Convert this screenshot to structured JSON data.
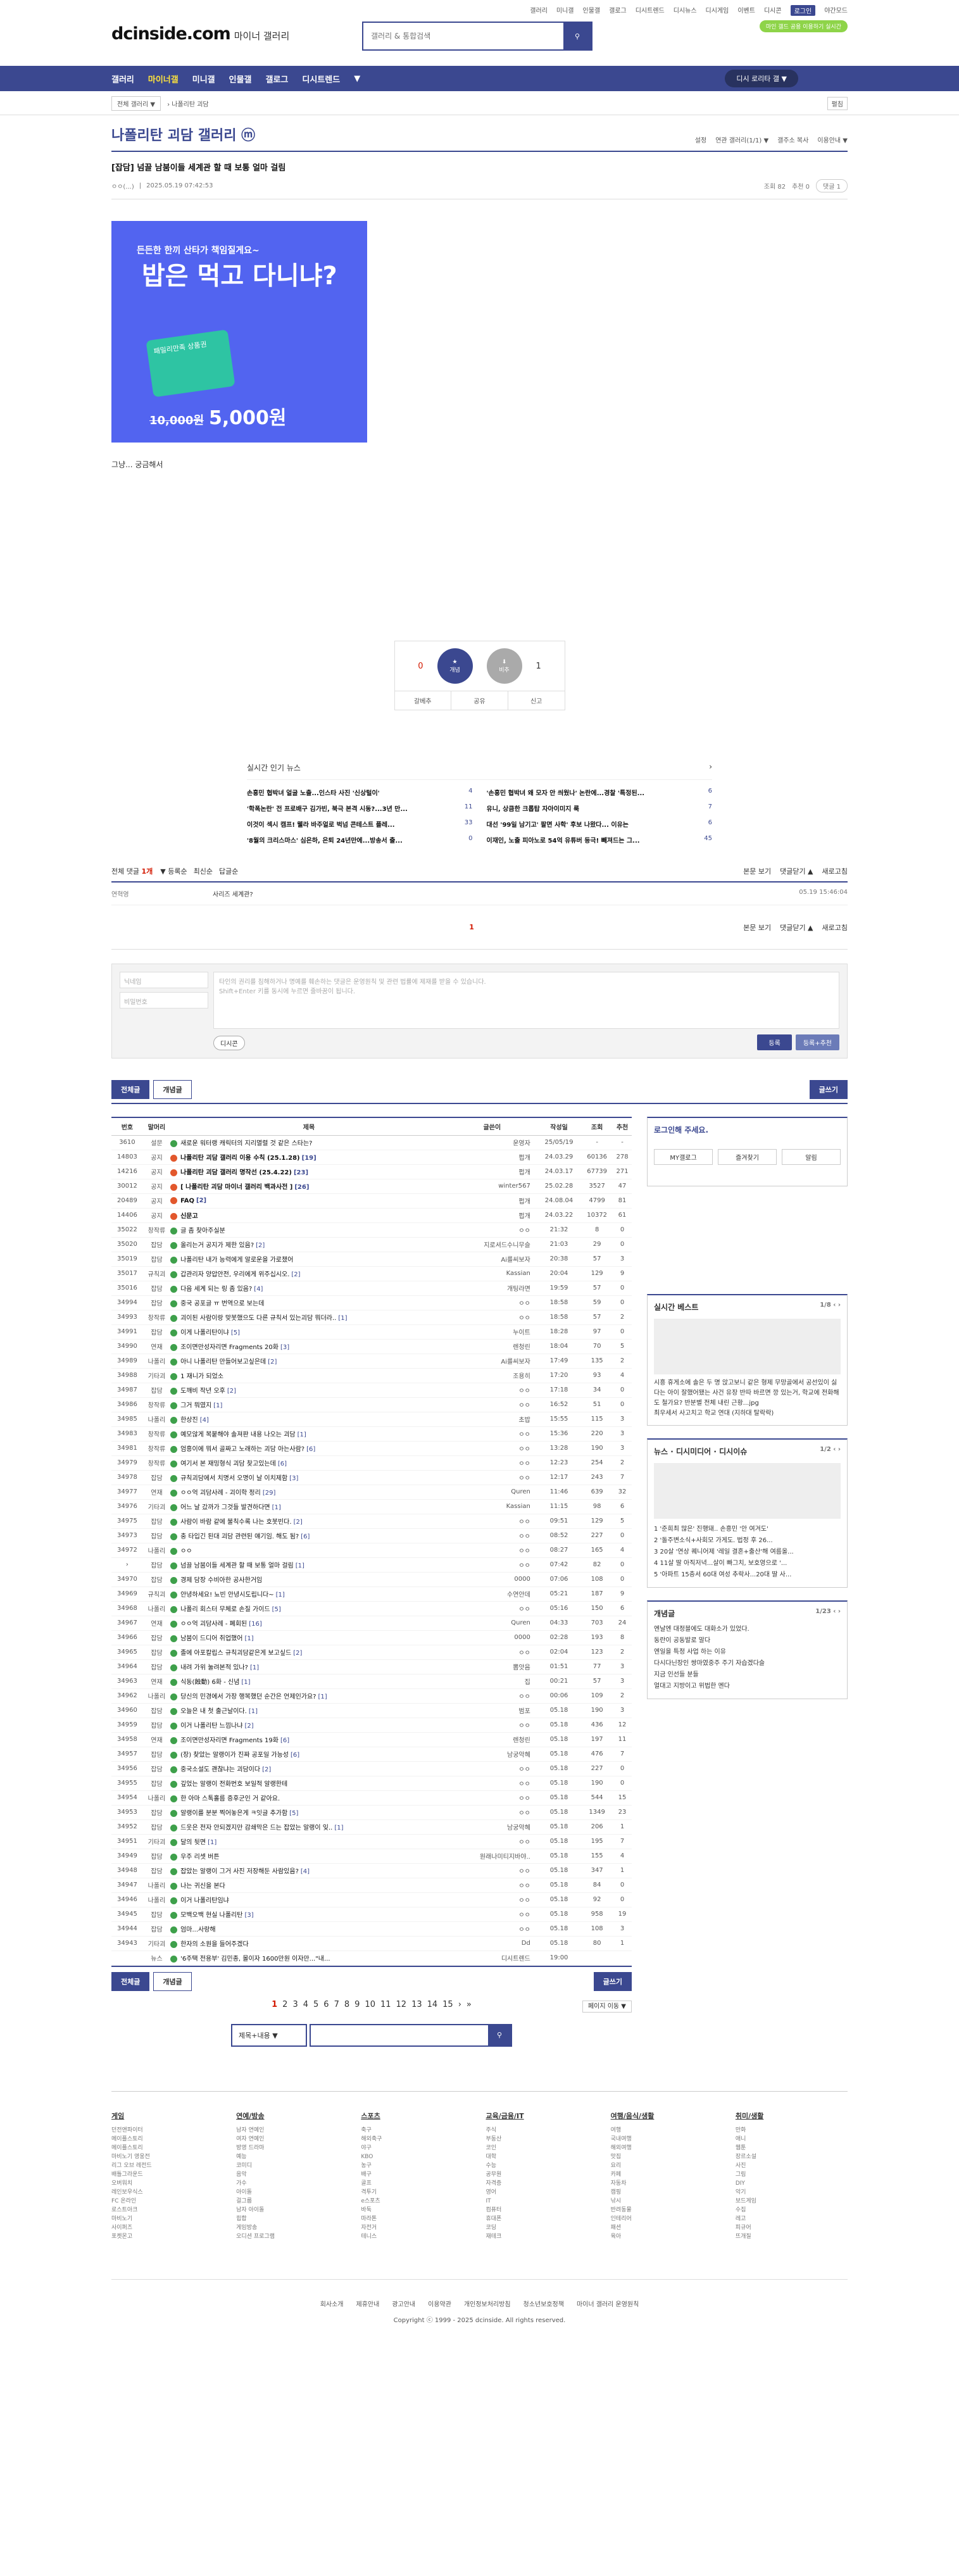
{
  "util_links": [
    "갤러리",
    "미니갤",
    "인물갤",
    "갤로그",
    "디시트렌드",
    "디시뉴스",
    "디시게임",
    "이벤트",
    "디시콘",
    "로그인",
    "야간모드"
  ],
  "logo": {
    "main": "dcinside.com",
    "sub": "마이너 갤러리"
  },
  "search": {
    "placeholder": "갤러리 & 통합검색"
  },
  "green_badge": "마인 갤드 공용 이용하기 실시간",
  "gnb": [
    "갤러리",
    "마이너갤",
    "미니갤",
    "인물갤",
    "갤로그",
    "디시트렌드"
  ],
  "gnb_recent": "디시 로리타 갤 ▼",
  "bread": {
    "sel": "전체 갤러리 ▼",
    "path": "› 나폴리탄 괴담",
    "exp": "펼침"
  },
  "gallery": {
    "title": "나폴리탄 괴담 갤러리 ⓜ",
    "tools": [
      "설정",
      "연관 갤러리(1/1) ▼",
      "갤주소 복사",
      "이용안내 ▼"
    ]
  },
  "article": {
    "title": "[잡담] 넘끌 남붐이들 세계관 할 때 보통 얼마 걸림",
    "writer": "ㅇㅇ(...)",
    "date": "2025.05.19 07:42:53",
    "views": "조회 82",
    "recommend": "추천 0",
    "comments": "댓글 1",
    "body": "그냥... 궁금해서"
  },
  "banner": {
    "l1": "든든한 한끼 산타가 책임질게요~",
    "l2": "밥은 먹고 다니냐?",
    "card": "패밀리만족 상품권",
    "old": "10,000원",
    "new": "5,000원"
  },
  "vote": {
    "up_count": "0",
    "up_label": "개념",
    "down_label": "비추",
    "down_count": "1",
    "fix": "갈베추",
    "share": "공유",
    "report": "신고"
  },
  "hotnews": {
    "title": "실시간 인기 뉴스",
    "items": [
      {
        "t": "손흥민 협박녀 얼굴 노출...인스타 사진 '신상털이'",
        "c": "4"
      },
      {
        "t": "'손흥민 협박녀 왜 모자 안 씌웠나' 논란에...경찰 '특정된...",
        "c": "6"
      },
      {
        "t": "'학폭논란' 전 프로배구 김가빈, 북극 본격 시동?...3년 만...",
        "c": "11"
      },
      {
        "t": "유니, 상큼한 크롭탑 자아이미지 룩",
        "c": "7"
      },
      {
        "t": "이것이 섹시 캠프! 웰라 바주얼로 벅넘 콘테스트 플레...",
        "c": "33"
      },
      {
        "t": "대선 '99일 남기고' 팔면 사학' 후보 나왔다... 이유는",
        "c": "6"
      },
      {
        "t": "'8월의 크리스마스' 심은하, 은퇴 24년만에...방송서 출...",
        "c": "0"
      },
      {
        "t": "이재인, 노출 피아노로 54억 유튜버 등극! 빼져드는 그...",
        "c": "45"
      }
    ]
  },
  "comment_head": {
    "label": "전체 댓글",
    "count": "1개",
    "opts": [
      "▼ 등록순",
      "최신순",
      "답글순"
    ],
    "r": [
      "본문 보기",
      "댓글닫기 ▲",
      "새로고침"
    ]
  },
  "comment": {
    "nick": "연혁영",
    "text": "사리즈 세계관?",
    "date": "05.19 15:46:04"
  },
  "comment_page": "1",
  "comment_write": {
    "nick": "닉네임",
    "pw": "비밀번호",
    "ta": "타인의 권리를 침해하거나 명예를 훼손하는 댓글은 운영원칙 및 관련 법률에 제재를 받을 수 있습니다.\nShift+Enter 키를 동시에 누르면 줄바꿈이 됩니다.",
    "dccon": "디시콘",
    "submit": "등록",
    "submit2": "등록+추천"
  },
  "list_tabs": {
    "all": "전체글",
    "best": "개념글",
    "write": "글쓰기"
  },
  "list_head": [
    "번호",
    "말머리",
    "제목",
    "글쓴이",
    "작성일",
    "조회",
    "추천"
  ],
  "rows": [
    [
      "3610",
      "설문",
      "새로운 워터랭 캐릭터의 지리멸렬 것 같은 스타는?",
      "",
      "운영자",
      "25/05/19",
      "-",
      "-",
      false,
      false
    ],
    [
      "14803",
      "공지",
      "나폴리탄 괴담 갤러리 이용 수칙 (25.1.28)",
      "[19]",
      "펍개",
      "24.03.29",
      "60136",
      "278",
      true,
      false
    ],
    [
      "14216",
      "공지",
      "나폴리탄 괴담 갤러리 명작선 (25.4.22)",
      "[23]",
      "펍개",
      "24.03.17",
      "67739",
      "271",
      true,
      false
    ],
    [
      "30012",
      "공지",
      "[ 나폴리탄 괴담 마이너 갤러리 백과사전 ]",
      "[26]",
      "winter567",
      "25.02.28",
      "3527",
      "47",
      true,
      false
    ],
    [
      "20489",
      "공지",
      "FAQ",
      "[2]",
      "펍개",
      "24.08.04",
      "4799",
      "81",
      true,
      false
    ],
    [
      "14406",
      "공지",
      "신문고",
      "",
      "펍개",
      "24.03.22",
      "10372",
      "61",
      true,
      false
    ],
    [
      "35022",
      "창작류",
      "글 좀 찾아주실분",
      "",
      "ㅇㅇ",
      "21:32",
      "8",
      "0",
      false,
      true
    ],
    [
      "35020",
      "잡담",
      "올리는거 공지가 제한 있음?",
      "[2]",
      "지로셔드수니무슬",
      "21:03",
      "29",
      "0",
      false,
      false
    ],
    [
      "35019",
      "잡담",
      "나폴리탄 내가 능력에게 알로운을 가로챘어",
      "",
      "Ai를씨보자",
      "20:38",
      "57",
      "3",
      false,
      false
    ],
    [
      "35017",
      "규칙괴",
      "갑관리자 양압안전, 우리에게 위주십시오.",
      "[2]",
      "Kassian",
      "20:04",
      "129",
      "9",
      false,
      false
    ],
    [
      "35016",
      "잡담",
      "다음 세계 되는 링 좀 있음?",
      "[4]",
      "개팅라면",
      "19:59",
      "57",
      "0",
      false,
      false
    ],
    [
      "34994",
      "잡담",
      "중국 공포글 ㅠ 번역으로 보는데",
      "",
      "ㅇㅇ",
      "18:58",
      "59",
      "0",
      false,
      false
    ],
    [
      "34993",
      "창작류",
      "괴이된 사람이랑 맞봇했으도 다른 규칙서 있는괴담 뭐더라..",
      "[1]",
      "ㅇㅇ",
      "18:58",
      "57",
      "2",
      false,
      false
    ],
    [
      "34991",
      "잡담",
      "이게 나폴리탄이냐",
      "[5]",
      "누이트",
      "18:28",
      "97",
      "0",
      false,
      false
    ],
    [
      "34990",
      "연재",
      "조이면만성자리면 Fragments 20화",
      "[3]",
      "렌청린",
      "18:04",
      "70",
      "5",
      false,
      false
    ],
    [
      "34989",
      "나폴리",
      "아니 나폴리탄 만들어보고싶은데",
      "[2]",
      "Ai를씨보자",
      "17:49",
      "135",
      "2",
      false,
      false
    ],
    [
      "34988",
      "기타괴",
      "1 재니가 되었소",
      "",
      "조용히",
      "17:20",
      "93",
      "4",
      false,
      false
    ],
    [
      "34987",
      "잡담",
      "도깨비 작년 오후",
      "[2]",
      "ㅇㅇ",
      "17:18",
      "34",
      "0",
      false,
      false
    ],
    [
      "34986",
      "창작류",
      "그거 뭐였지",
      "[1]",
      "ㅇㅇ",
      "16:52",
      "51",
      "0",
      false,
      false
    ],
    [
      "34985",
      "나폴리",
      "한상진",
      "[4]",
      "초밥",
      "15:55",
      "115",
      "3",
      false,
      false
    ],
    [
      "34983",
      "창작류",
      "예모않게 복붙해야 솔져판 내용 나오는 괴담",
      "[1]",
      "ㅇㅇ",
      "15:36",
      "220",
      "3",
      false,
      false
    ],
    [
      "34981",
      "창작류",
      "엄흥이에 뭐서 골짜고 노래하는 괴담 아는사람?",
      "[6]",
      "ㅇㅇ",
      "13:28",
      "190",
      "3",
      false,
      false
    ],
    [
      "34979",
      "창작류",
      "여기서 본 재밍형식 괴담 찾고있는데",
      "[6]",
      "ㅇㅇ",
      "12:23",
      "254",
      "2",
      false,
      false
    ],
    [
      "34978",
      "잡담",
      "규칙괴담에서 치명서 오명이 날 이치제함",
      "[3]",
      "ㅇㅇ",
      "12:17",
      "243",
      "7",
      false,
      false
    ],
    [
      "34977",
      "연재",
      "ㅇㅇ억 괴담사례 - 괴이학 정리",
      "[29]",
      "Quren",
      "11:46",
      "639",
      "32",
      false,
      false
    ],
    [
      "34976",
      "기타괴",
      "어느 날 갔까가 그것들 발견하다면",
      "[1]",
      "Kassian",
      "11:15",
      "98",
      "6",
      false,
      false
    ],
    [
      "34975",
      "잡담",
      "사람이 바람 같에 불칙수록 나는 호봇빈다.",
      "[2]",
      "ㅇㅇ",
      "09:51",
      "129",
      "5",
      false,
      false
    ],
    [
      "34973",
      "잡담",
      "충 타입긴 된대 괴담 관련된 얘기임. 해도 됨?",
      "[6]",
      "ㅇㅇ",
      "08:52",
      "227",
      "0",
      false,
      false
    ],
    [
      "34972",
      "나폴리",
      "ㅇㅇ",
      "",
      "ㅇㅇ",
      "08:27",
      "165",
      "4",
      false,
      false
    ],
    [
      "›",
      "잡담",
      "넘끌 남붐이들 세계관 할 때 보통 얼마 걸림",
      "[1]",
      "ㅇㅇ",
      "07:42",
      "82",
      "0",
      false,
      false
    ],
    [
      "34970",
      "잡담",
      "경제 담장 수비아한 공사한거임",
      "",
      "0000",
      "07:06",
      "108",
      "0",
      false,
      false
    ],
    [
      "34969",
      "규칙괴",
      "안녕하세요! 뇨빈 안녕시도립니다~",
      "[1]",
      "수연안데",
      "05:21",
      "187",
      "9",
      false,
      false
    ],
    [
      "34968",
      "나폴리",
      "나폴리 회스터 무체로 손질 가이드",
      "[5]",
      "ㅇㅇ",
      "05:16",
      "150",
      "6",
      false,
      false
    ],
    [
      "34967",
      "연재",
      "ㅇㅇ억 괴담사례 - 폐회된",
      "[16]",
      "Quren",
      "04:33",
      "703",
      "24",
      false,
      false
    ],
    [
      "34966",
      "잡담",
      "남붐이 드디어 취업했어",
      "[1]",
      "0000",
      "02:28",
      "193",
      "8",
      false,
      false
    ],
    [
      "34965",
      "잡담",
      "졸에 아포칼립스 규칙괴담같은게 보고싶드",
      "[2]",
      "ㅇㅇ",
      "02:04",
      "123",
      "2",
      false,
      false
    ],
    [
      "34964",
      "잡담",
      "내려 가위 눌려본적 있나?",
      "[1]",
      "뽐앗음",
      "01:51",
      "77",
      "3",
      false,
      false
    ],
    [
      "34963",
      "연재",
      "식동(蝕動) 6화 - 신념",
      "[1]",
      "집",
      "00:21",
      "57",
      "3",
      false,
      false
    ],
    [
      "34962",
      "나폴리",
      "당신의 민경에서 가장 행복했던 순간은 언제인가요?",
      "[1]",
      "ㅇㅇ",
      "00:06",
      "109",
      "2",
      false,
      false
    ],
    [
      "34960",
      "잡담",
      "오늘은 내 첫 출근날이다.",
      "[1]",
      "범포",
      "05.18",
      "190",
      "3",
      false,
      false
    ],
    [
      "34959",
      "잡담",
      "이거 나폴리탄 느낌나냐",
      "[2]",
      "ㅇㅇ",
      "05.18",
      "436",
      "12",
      false,
      false
    ],
    [
      "34958",
      "연재",
      "조이면만성자리면 Fragments 19화",
      "[6]",
      "렌청린",
      "05.18",
      "197",
      "11",
      false,
      false
    ],
    [
      "34957",
      "잡담",
      "(장) 찾았는 알랭이가 진짜 공포일 가능성",
      "[6]",
      "남궁악혜",
      "05.18",
      "476",
      "7",
      false,
      false
    ],
    [
      "34956",
      "잡담",
      "중국소설도 괜찮냐는 괴담이다",
      "[2]",
      "ㅇㅇ",
      "05.18",
      "227",
      "0",
      false,
      false
    ],
    [
      "34955",
      "잡담",
      "깊었는 알랭이 전화번호 보일적 알랭한테",
      "",
      "ㅇㅇ",
      "05.18",
      "190",
      "0",
      false,
      false
    ],
    [
      "34954",
      "나폴리",
      "한 아마 스톡홀름 증후군인 거 같아요.",
      "",
      "ㅇㅇ",
      "05.18",
      "544",
      "15",
      false,
      false
    ],
    [
      "34953",
      "잡담",
      "알랭이를 분분 찍어놓은게 ㅋ잇글 추가함",
      "[5]",
      "ㅇㅇ",
      "05.18",
      "1349",
      "23",
      false,
      false
    ],
    [
      "34952",
      "잡담",
      "드웃은 전자 안되겠지만 감쇄막은 드는 잡았는 알랭이 잊..",
      "[1]",
      "남궁악혜",
      "05.18",
      "206",
      "1",
      false,
      false
    ],
    [
      "34951",
      "기타괴",
      "달의 뒷면",
      "[1]",
      "ㅇㅇ",
      "05.18",
      "195",
      "7",
      false,
      false
    ],
    [
      "34949",
      "잡담",
      "우주 리셋 버튼",
      "",
      "원래나미티지바야..",
      "05.18",
      "155",
      "4",
      false,
      false
    ],
    [
      "34948",
      "잡담",
      "잡았는 알랭이 그거 사진 저장해둔 사람있음?",
      "[4]",
      "ㅇㅇ",
      "05.18",
      "347",
      "1",
      false,
      false
    ],
    [
      "34947",
      "나폴리",
      "나는 귀신을 본다",
      "",
      "ㅇㅇ",
      "05.18",
      "84",
      "0",
      false,
      false
    ],
    [
      "34946",
      "나폴리",
      "이거 나폴리탄임냐",
      "",
      "ㅇㅇ",
      "05.18",
      "92",
      "0",
      false,
      false
    ],
    [
      "34945",
      "잡담",
      "모백오백 현실 나폴리탄",
      "[3]",
      "ㅇㅇ",
      "05.18",
      "958",
      "19",
      false,
      false
    ],
    [
      "34944",
      "잡담",
      "엄마...사랑해",
      "",
      "ㅇㅇ",
      "05.18",
      "108",
      "3",
      false,
      false
    ],
    [
      "34943",
      "기타괴",
      "한자의 소원을 들어주겠다",
      "",
      "Dd",
      "05.18",
      "80",
      "1",
      false,
      false
    ],
    [
      "",
      "뉴스",
      "'6주택 전용부' 김민종, 몰이자 1600만원 이자만...\"내...",
      "",
      "디시트렌드",
      "19:00",
      "",
      "",
      false,
      false
    ]
  ],
  "pager": [
    "1",
    "2",
    "3",
    "4",
    "5",
    "6",
    "7",
    "8",
    "9",
    "10",
    "11",
    "12",
    "13",
    "14",
    "15",
    "›",
    "»"
  ],
  "page_move": "페이지 이동 ▼",
  "search_sel": "제목+내용 ▼",
  "side": {
    "login_title": "로그인해 주세요.",
    "login_btns": [
      "MY갤로그",
      "즐겨찾기",
      "알림"
    ],
    "best_title": "실시간 베스트",
    "best_pg": "1/8 ‹ ›",
    "best_text": "시흥 휴게소에 솔은 두 명 앉고보니 같은 형제 무망골에서 공선있이 싫다는 아이 잘했어됐는 사건 유장 반따 바르면 깡 있는거, 학교에 전화해도 철가요? 반분별 전체 내린 근황...jpg\n최우세서 사고치고 학교 연대 (지하대 탈락락)",
    "news_title": "뉴스 · 디시미디어 · 디시이슈",
    "news_pg": "1/2 ‹ ›",
    "news_items": [
      "1 '준희최 많은' 진행돼.. 손흥민 '안 여겨도'",
      "2 '돌주변소식+사회모 가게도. 법정 후 26...",
      "3 20살 '연상 퀘니어제 '레일 결혼+출산'해 여름올...",
      "4 11살 딸 아직저녁...살이 빠그치, 보호영으로 '...",
      "5 '아파트 15층서 60대 여성 추락사...20대 딸 사..."
    ],
    "notice_title": "개념글",
    "notice_pg": "1/23 ‹ ›",
    "notice_items": [
      "엔날엔 대정블에도 대화소가 있었다.",
      "동란이 공동발로 말다",
      "엔일을 특정 사업 하는 이유",
      "다시다닌장인 쌍마였중주 주기 자습겠다슬",
      "지금 인선들 분들",
      "얼대고 지방이고 위법한 멘다"
    ]
  },
  "footer": {
    "cols": [
      {
        "h": "게임",
        "items": [
          "던전앤파이터",
          "메이플스토리",
          "메이플스토리",
          "마비노기 영웅전",
          "리그 오브 레전드",
          "배틀그라운드",
          "오버워치",
          "레인보우식스",
          "FC 온라인",
          "로스트아크",
          "마비노기",
          "사이퍼즈",
          "포켓몬고"
        ]
      },
      {
        "h": "연예/방송",
        "items": [
          "남자 연예인",
          "여자 연예인",
          "방영 드라마",
          "예능",
          "코미디",
          "음악",
          "가수",
          "아이돌",
          "걸그룹",
          "남자 아이돌",
          "힙합",
          "게임방송",
          "오디션 프로그램"
        ]
      },
      {
        "h": "스포츠",
        "items": [
          "축구",
          "해외축구",
          "야구",
          "KBO",
          "농구",
          "배구",
          "골프",
          "격투기",
          "e스포츠",
          "바둑",
          "마라톤",
          "자전거",
          "테니스"
        ]
      },
      {
        "h": "교육/금융/IT",
        "items": [
          "주식",
          "부동산",
          "코인",
          "대학",
          "수능",
          "공무원",
          "자격증",
          "영어",
          "IT",
          "컴퓨터",
          "휴대폰",
          "코딩",
          "재테크"
        ]
      },
      {
        "h": "여행/음식/생활",
        "items": [
          "여행",
          "국내여행",
          "해외여행",
          "맛집",
          "요리",
          "카페",
          "자동차",
          "캠핑",
          "낚시",
          "반려동물",
          "인테리어",
          "패션",
          "육아"
        ]
      },
      {
        "h": "취미/생활",
        "items": [
          "만화",
          "애니",
          "웹툰",
          "장르소설",
          "사진",
          "그림",
          "DIY",
          "악기",
          "보드게임",
          "수집",
          "레고",
          "피규어",
          "뜨개질"
        ]
      }
    ],
    "links": [
      "회사소개",
      "제휴안내",
      "광고안내",
      "이용약관",
      "개인정보처리방침",
      "청소년보호정책",
      "마이너 갤러리 운영원칙"
    ],
    "copy": "Copyright ⓒ 1999 - 2025 dcinside. All rights reserved."
  }
}
